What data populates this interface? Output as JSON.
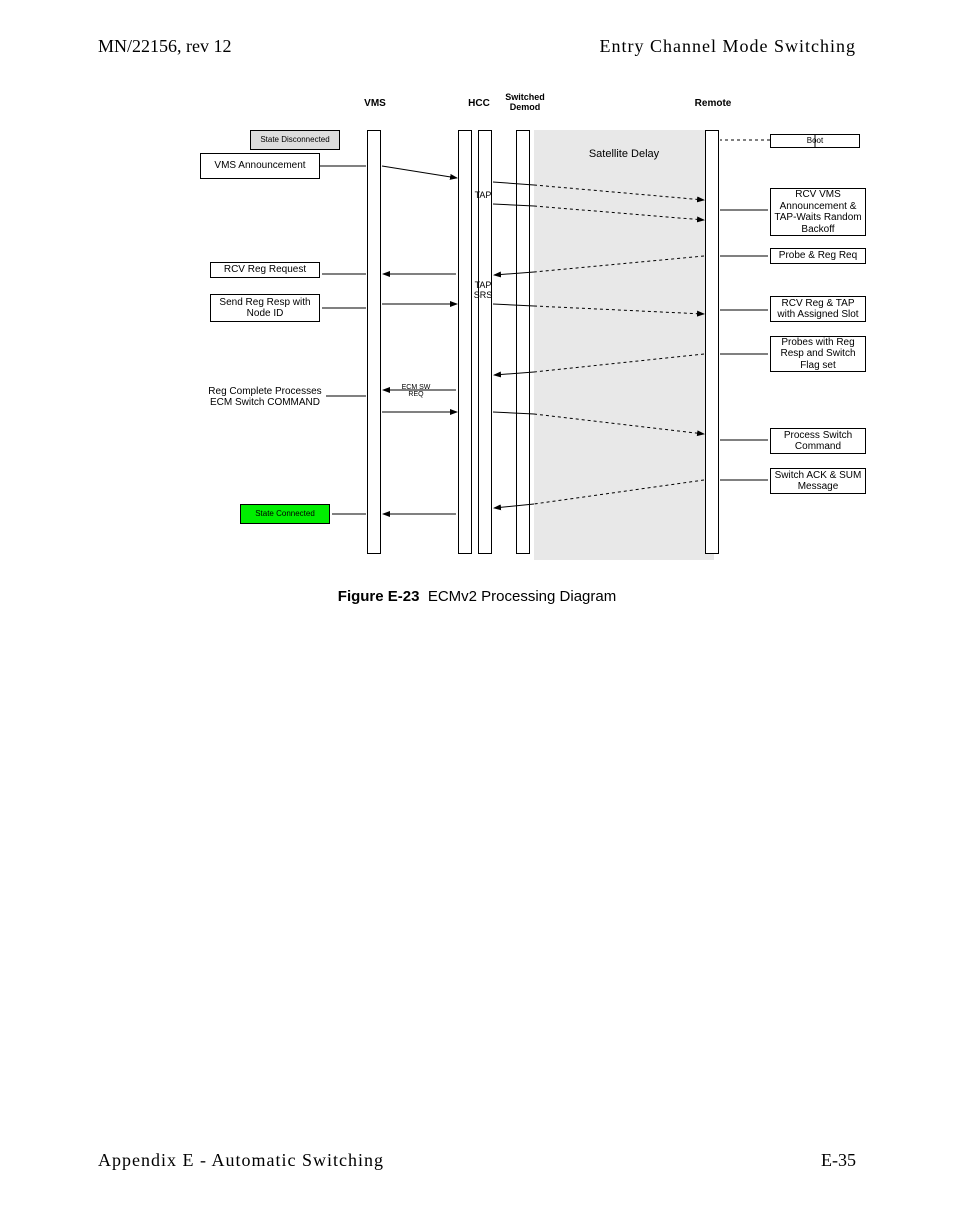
{
  "header": {
    "left": "MN/22156, rev 12",
    "right": "Entry Channel Mode Switching"
  },
  "footer": {
    "left": "Appendix E - Automatic Switching",
    "right": "E-35"
  },
  "caption": {
    "label": "Figure E-23",
    "text": "ECMv2 Processing Diagram"
  },
  "diagram": {
    "columns": {
      "vms": "VMS",
      "hcc": "HCC",
      "demod": "Switched Demod",
      "remote": "Remote"
    },
    "left_boxes": {
      "state_disconnected": "State Disconnected",
      "vms_announcement": "VMS Announcement",
      "rcv_reg_request": "RCV Reg Request",
      "send_reg_resp": "Send Reg Resp with Node ID",
      "reg_complete": "Reg Complete Processes ECM Switch COMMAND",
      "state_connected": "State Connected"
    },
    "right_boxes": {
      "boot": "Boot",
      "rcv_vms": "RCV VMS Announcement & TAP-Waits Random Backoff",
      "probe_reg": "Probe & Reg Req",
      "rcv_reg_tap": "RCV Reg & TAP with Assigned Slot",
      "probes_flag": "Probes with Reg Resp and Switch Flag set",
      "process_switch": "Process Switch Command",
      "switch_ack": "Switch ACK & SUM Message"
    },
    "mid_labels": {
      "tap1": "TAP",
      "tap2": "TAP",
      "srs": "SRS",
      "ecm_sw_req": "ECM SW REQ"
    },
    "sat_delay": "Satellite Delay"
  }
}
